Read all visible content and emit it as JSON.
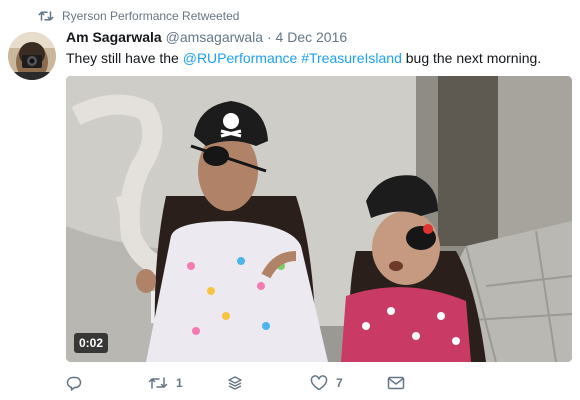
{
  "retweet_notice": {
    "text": "Ryerson Performance Retweeted",
    "icon": "retweet-icon"
  },
  "author": {
    "name": "Am Sagarwala",
    "handle": "@amsagarwala",
    "separator": "·",
    "date": "4 Dec 2016"
  },
  "tweet": {
    "text_before": "They still have the ",
    "mention": "@RUPerformance",
    "space": " ",
    "hashtag": "#TreasureIsland",
    "text_after": " bug the next morning."
  },
  "media": {
    "duration": "0:02"
  },
  "actions": {
    "reply": {
      "icon": "reply-icon",
      "count": ""
    },
    "retweet": {
      "icon": "retweet-icon",
      "count": "1"
    },
    "stack": {
      "icon": "stack-icon",
      "count": ""
    },
    "like": {
      "icon": "heart-icon",
      "count": "7"
    },
    "dm": {
      "icon": "envelope-icon",
      "count": ""
    }
  },
  "colors": {
    "link": "#1da1f2",
    "muted": "#657786",
    "text": "#14171a"
  }
}
